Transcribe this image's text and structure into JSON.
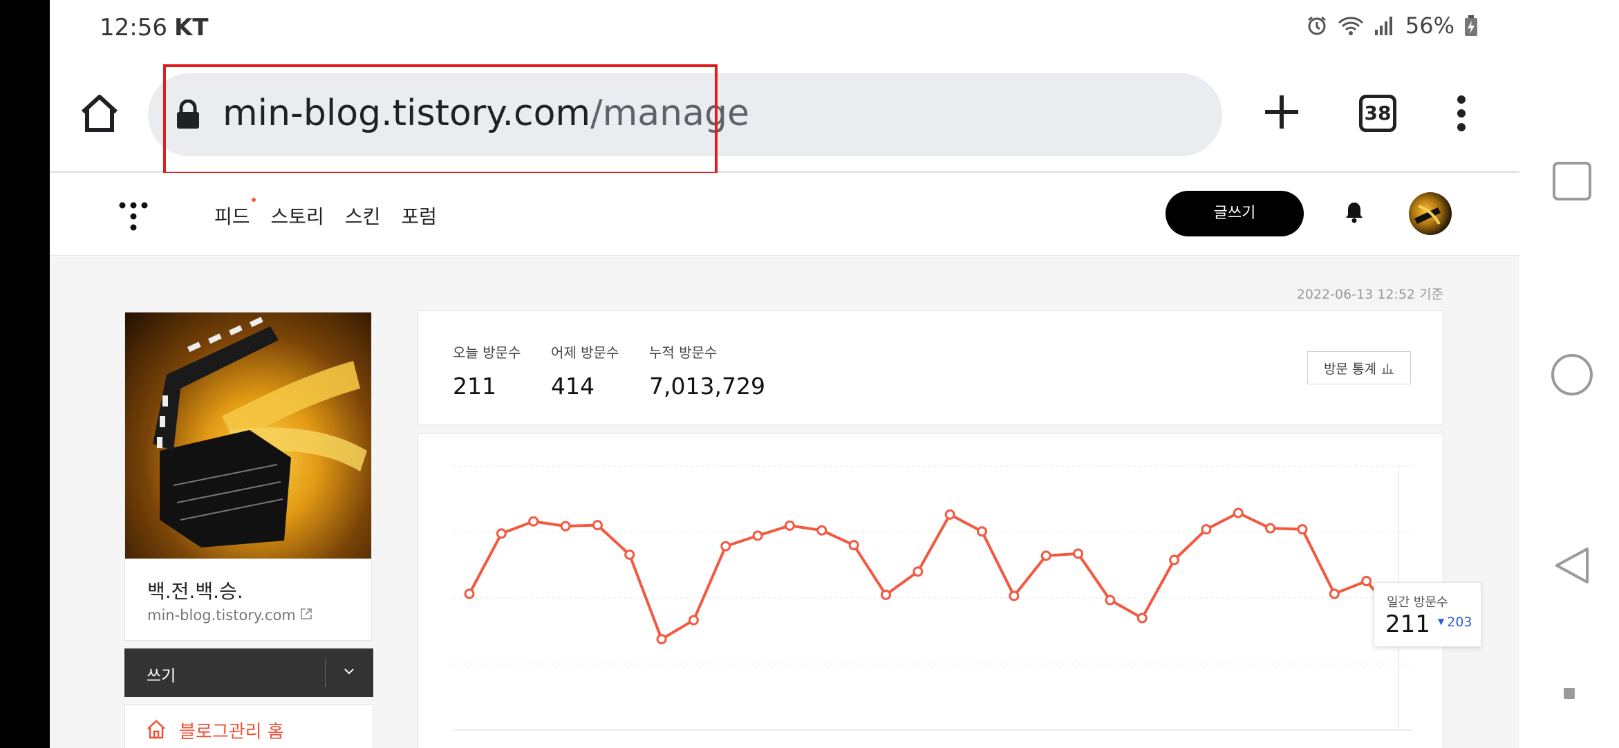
{
  "status_bar": {
    "time": "12:56",
    "carrier": "KT",
    "battery": "56%"
  },
  "browser": {
    "url_host": "min-blog.tistory.com",
    "url_path": "/manage",
    "tab_count": "38"
  },
  "site_nav": {
    "items": [
      "피드",
      "스토리",
      "스킨",
      "포럼"
    ],
    "write_label": "글쓰기"
  },
  "content": {
    "timestamp": "2022-06-13 12:52 기준",
    "blog_name": "백.전.백.승.",
    "blog_url": "min-blog.tistory.com",
    "write_label": "쓰기",
    "menu_home_label": "블로그관리 홈"
  },
  "stats": {
    "today_label": "오늘 방문수",
    "today_value": "211",
    "yesterday_label": "어제 방문수",
    "yesterday_value": "414",
    "total_label": "누적 방문수",
    "total_value": "7,013,729",
    "button_label": "방문 통계"
  },
  "tooltip": {
    "label": "일간 방문수",
    "value": "211",
    "prev": "203"
  },
  "colors": {
    "accent": "#f35840",
    "highlight_box": "#e01c1c",
    "tooltip_prev": "#2f5bd9"
  },
  "chart_data": {
    "type": "line",
    "series": [
      {
        "values": [
          258,
          372,
          395,
          386,
          388,
          332,
          172,
          208,
          348,
          368,
          387,
          378,
          350,
          256,
          300,
          408,
          376,
          254,
          330,
          334,
          246,
          212,
          322,
          380,
          411,
          382,
          380,
          258,
          282,
          211
        ]
      }
    ],
    "ylim": [
      0,
      500
    ],
    "grid": true
  }
}
